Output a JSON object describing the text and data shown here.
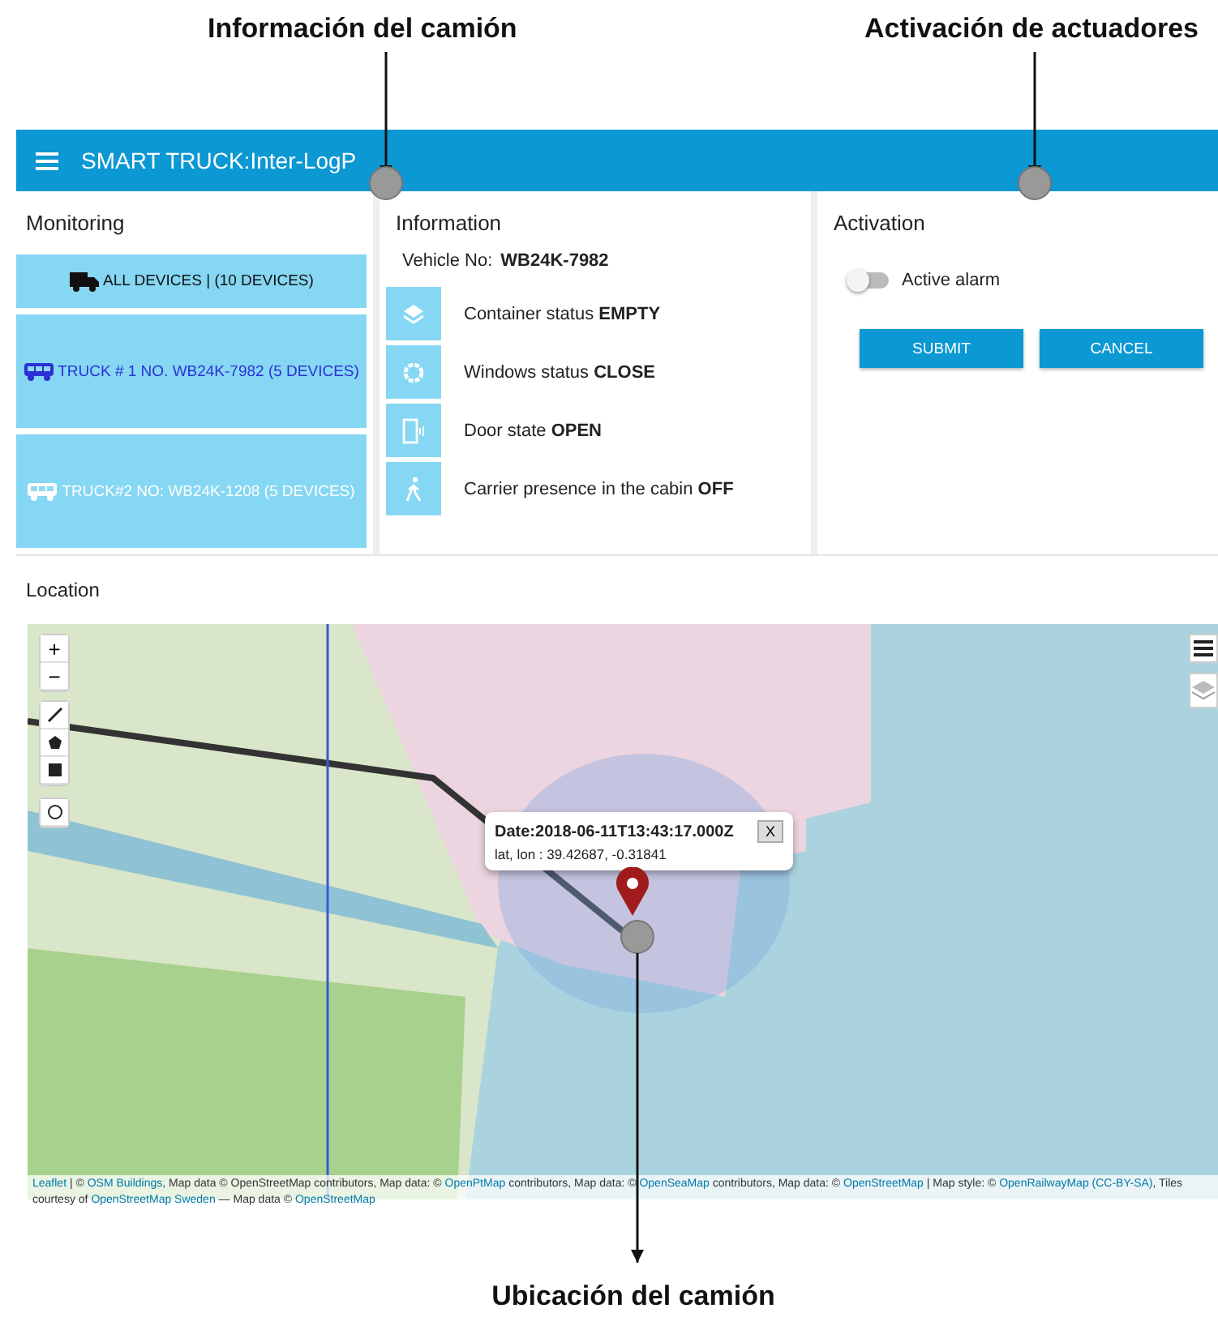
{
  "annotations": {
    "top": [
      "Información del camión",
      "Activación de actuadores"
    ],
    "bottom": "Ubicación del camión"
  },
  "app_bar": {
    "title": "SMART TRUCK:Inter-LogP"
  },
  "monitoring": {
    "title": "Monitoring",
    "items": [
      {
        "label": "ALL DEVICES | (10 DEVICES)",
        "kind": "all"
      },
      {
        "label": "TRUCK # 1 NO. WB24K-7982 (5 DEVICES)",
        "kind": "online"
      },
      {
        "label": "TRUCK#2 NO: WB24K-1208 (5 DEVICES)",
        "kind": "offline"
      }
    ]
  },
  "information": {
    "title": "Information",
    "vehicle_label": "Vehicle No:",
    "vehicle_no": "WB24K-7982",
    "rows": [
      {
        "kind": "layers",
        "label": "Container status",
        "value": "EMPTY"
      },
      {
        "kind": "gear",
        "label": "Windows status",
        "value": "CLOSE"
      },
      {
        "kind": "door",
        "label": "Door state",
        "value": "OPEN"
      },
      {
        "kind": "walk",
        "label": "Carrier presence in the cabin",
        "value": "OFF"
      }
    ]
  },
  "activation": {
    "title": "Activation",
    "toggle": {
      "label": "Active alarm",
      "on": false
    },
    "buttons": [
      "SUBMIT",
      "CANCEL"
    ]
  },
  "location": {
    "title": "Location",
    "zoom_in": "+",
    "zoom_out": "−",
    "popup": {
      "title": "Date:2018-06-11T13:43:17.000Z",
      "coords": "lat, lon : 39.42687, -0.31841",
      "close": "X"
    },
    "attribution": [
      {
        "text": "Leaflet",
        "link": true
      },
      {
        "text": " | © ",
        "link": false
      },
      {
        "text": "OSM Buildings",
        "link": true
      },
      {
        "text": ", Map data © OpenStreetMap contributors, Map data: © ",
        "link": false
      },
      {
        "text": "OpenPtMap",
        "link": true
      },
      {
        "text": " contributors, Map data: © ",
        "link": false
      },
      {
        "text": "OpenSeaMap",
        "link": true
      },
      {
        "text": " contributors, Map data: © ",
        "link": false
      },
      {
        "text": "OpenStreetMap",
        "link": true
      },
      {
        "text": " | Map style: © ",
        "link": false
      },
      {
        "text": "OpenRailwayMap",
        "link": true
      },
      {
        "text": " (CC-BY-SA)",
        "link": true
      },
      {
        "text": ", Tiles courtesy of ",
        "link": false
      },
      {
        "text": "OpenStreetMap Sweden",
        "link": true
      },
      {
        "text": " — Map data © ",
        "link": false
      },
      {
        "text": "OpenStreetMap",
        "link": true
      }
    ]
  }
}
